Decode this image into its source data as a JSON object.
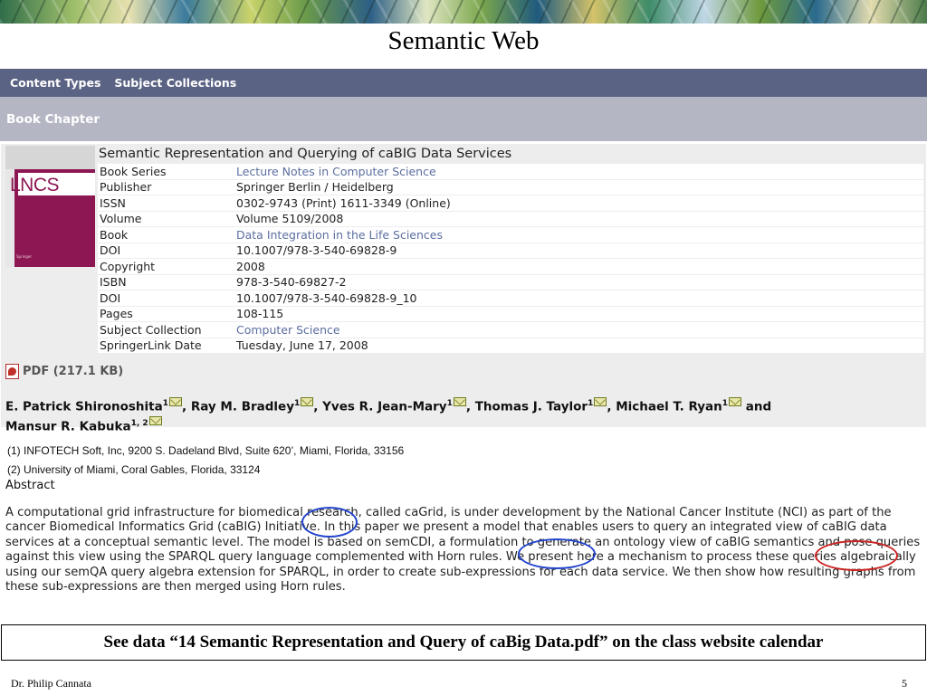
{
  "slide": {
    "title": "Semantic Web",
    "caption": "See data “14 Semantic Representation and Query of caBig Data.pdf” on the class website calendar",
    "author": "Dr. Philip Cannata",
    "page_number": "5"
  },
  "nav": {
    "items": [
      "Content Types",
      "Subject Collections"
    ]
  },
  "section": {
    "label": "Book Chapter"
  },
  "cover": {
    "series_text": "LNCS",
    "publisher_text": "Springer"
  },
  "record": {
    "title": "Semantic Representation and Querying of caBIG Data Services",
    "rows": [
      {
        "key": "Book Series",
        "value": "Lecture Notes in Computer Science",
        "link": true
      },
      {
        "key": "Publisher",
        "value": "Springer Berlin / Heidelberg",
        "link": false
      },
      {
        "key": "ISSN",
        "value": "0302-9743 (Print) 1611-3349 (Online)",
        "link": false
      },
      {
        "key": "Volume",
        "value": "Volume 5109/2008",
        "link": false
      },
      {
        "key": "Book",
        "value": "Data Integration in the Life Sciences",
        "link": true
      },
      {
        "key": "DOI",
        "value": "10.1007/978-3-540-69828-9",
        "link": false
      },
      {
        "key": "Copyright",
        "value": "2008",
        "link": false
      },
      {
        "key": "ISBN",
        "value": "978-3-540-69827-2",
        "link": false
      },
      {
        "key": "DOI",
        "value": "10.1007/978-3-540-69828-9_10",
        "link": false
      },
      {
        "key": "Pages",
        "value": "108-115",
        "link": false
      },
      {
        "key": "Subject Collection",
        "value": "Computer Science",
        "link": true
      },
      {
        "key": "SpringerLink Date",
        "value": "Tuesday, June 17, 2008",
        "link": false
      }
    ]
  },
  "pdf": {
    "label": "PDF (217.1 KB)"
  },
  "authors": {
    "list": [
      {
        "name": "E. Patrick Shironoshita",
        "sup": "1"
      },
      {
        "name": "Ray M. Bradley",
        "sup": "1"
      },
      {
        "name": "Yves R. Jean-Mary",
        "sup": "1"
      },
      {
        "name": "Thomas J. Taylor",
        "sup": "1"
      },
      {
        "name": "Michael T. Ryan",
        "sup": "1"
      },
      {
        "name": "Mansur R. Kabuka",
        "sup": "1, 2"
      }
    ],
    "sep": ", ",
    "and_word": " and"
  },
  "affiliations": [
    "(1)  INFOTECH Soft, Inc, 9200 S. Dadeland Blvd, Suite 620’, Miami, Florida, 33156",
    "(2)  University of Miami, Coral Gables, Florida, 33124"
  ],
  "abstract": {
    "heading": "Abstract",
    "text": "A computational grid infrastructure for biomedical research, called caGrid, is under development by the National Cancer Institute (NCI) as part of the cancer Biomedical Informatics Grid (caBIG) Initiative. In this paper we present a model that enables users to query an integrated view of caBIG data services at a conceptual semantic level. The model is based on semCDI, a formulation to generate an ontology view of caBIG semantics and pose queries against this view using the SPARQL query language complemented with Horn rules. We present here a mechanism to process these queries algebraically using our semQA query algebra extension for SPARQL, in order to create sub-expressions for each data service. We then show how resulting graphs from these sub-expressions are then merged using Horn rules."
  },
  "colors": {
    "annotation_blue": "#2244cc",
    "annotation_red": "#cc2222",
    "nav_bg": "#5b6384",
    "section_bg": "#b4b6c4"
  }
}
